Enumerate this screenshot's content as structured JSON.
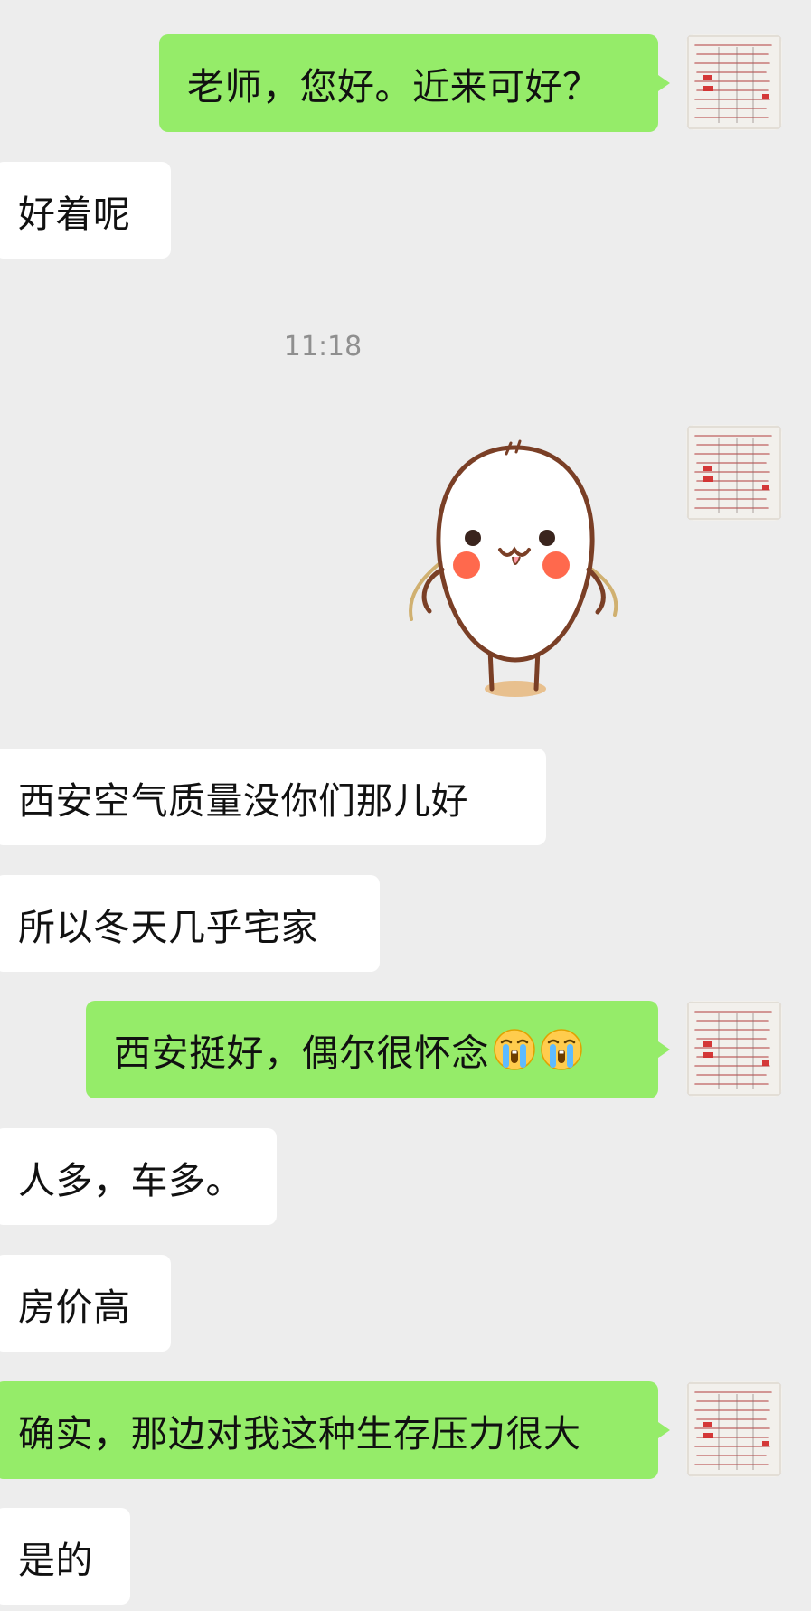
{
  "timestamp": "11:18",
  "messages": [
    {
      "id": 1,
      "direction": "outgoing",
      "type": "text",
      "text": "老师，您好。近来可好？"
    },
    {
      "id": 2,
      "direction": "incoming",
      "type": "text",
      "text": "好着呢"
    },
    {
      "id": 3,
      "direction": "outgoing",
      "type": "sticker",
      "sticker": "cute-white-blob-sticker"
    },
    {
      "id": 4,
      "direction": "incoming",
      "type": "text",
      "text": "西安空气质量没你们那儿好"
    },
    {
      "id": 5,
      "direction": "incoming",
      "type": "text",
      "text": "所以冬天几乎宅家"
    },
    {
      "id": 6,
      "direction": "outgoing",
      "type": "text",
      "text": "西安挺好，偶尔很怀念",
      "emojis": [
        "loudly-crying-face",
        "loudly-crying-face"
      ]
    },
    {
      "id": 7,
      "direction": "incoming",
      "type": "text",
      "text": "人多，车多。"
    },
    {
      "id": 8,
      "direction": "incoming",
      "type": "text",
      "text": "房价高"
    },
    {
      "id": 9,
      "direction": "outgoing",
      "type": "text",
      "text": "确实，那边对我这种生存压力很大"
    },
    {
      "id": 10,
      "direction": "incoming",
      "type": "text",
      "text": "是的"
    }
  ],
  "colors": {
    "background": "#ededed",
    "outgoing_bubble": "#95ec69",
    "incoming_bubble": "#ffffff",
    "timestamp_text": "#8f8f8f"
  },
  "icons": {
    "avatar": "calligraphy-avatar",
    "emoji": "loudly-crying-face"
  }
}
